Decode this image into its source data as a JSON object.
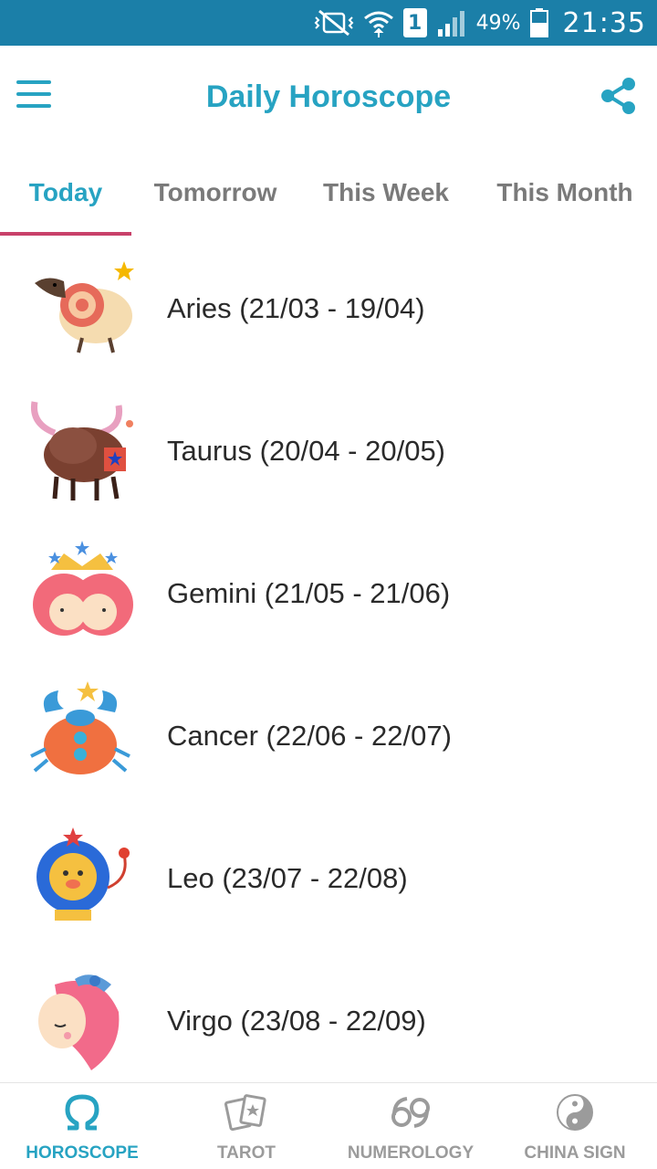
{
  "status_bar": {
    "battery_percent": "49%",
    "time": "21:35",
    "sim_slot": "1",
    "icons": [
      "vibrate-muted-icon",
      "wifi-icon",
      "sim-icon",
      "signal-icon",
      "battery-icon"
    ]
  },
  "app_bar": {
    "title": "Daily Horoscope",
    "menu_icon": "hamburger-menu-icon",
    "share_icon": "share-icon"
  },
  "tabs": [
    {
      "label": "Today",
      "active": true
    },
    {
      "label": "Tomorrow",
      "active": false
    },
    {
      "label": "This Week",
      "active": false
    },
    {
      "label": "This Month",
      "active": false
    }
  ],
  "signs": [
    {
      "label": "Aries (21/03 - 19/04)",
      "icon": "aries-ram-icon"
    },
    {
      "label": "Taurus (20/04 - 20/05)",
      "icon": "taurus-bull-icon"
    },
    {
      "label": "Gemini (21/05 - 21/06)",
      "icon": "gemini-twins-icon"
    },
    {
      "label": "Cancer (22/06 - 22/07)",
      "icon": "cancer-crab-icon"
    },
    {
      "label": "Leo (23/07 - 22/08)",
      "icon": "leo-lion-icon"
    },
    {
      "label": "Virgo (23/08 - 22/09)",
      "icon": "virgo-maiden-icon"
    }
  ],
  "bottom_nav": [
    {
      "label": "HOROSCOPE",
      "icon": "omega-icon",
      "active": true
    },
    {
      "label": "TAROT",
      "icon": "tarot-cards-icon",
      "active": false
    },
    {
      "label": "NUMEROLOGY",
      "icon": "numerology-69-icon",
      "active": false
    },
    {
      "label": "CHINA SIGN",
      "icon": "yin-yang-icon",
      "active": false
    }
  ],
  "colors": {
    "status_bar": "#1b7fa8",
    "accent": "#27a3c2",
    "tab_indicator": "#c8416a",
    "inactive_text": "#7a7a7a"
  }
}
